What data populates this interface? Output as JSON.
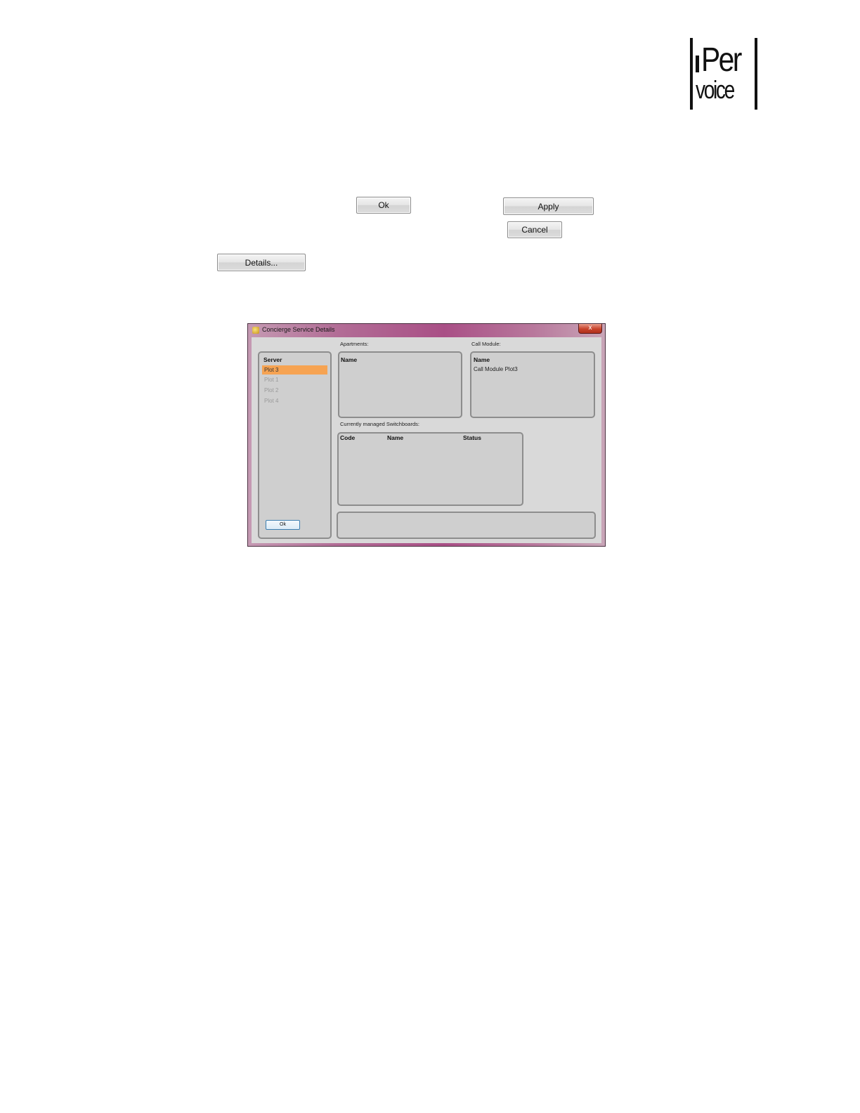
{
  "logo": {
    "line1": "Per",
    "line2": "voice"
  },
  "buttons": {
    "ok": "Ok",
    "apply": "Apply",
    "cancel": "Cancel",
    "details": "Details..."
  },
  "dialog": {
    "title": "Concierge Service Details",
    "close_glyph": "x",
    "server_list": {
      "header": "Server",
      "items": [
        "Plot 3",
        "Plot 1",
        "Plot 2",
        "Plot 4"
      ],
      "selected_index": 0
    },
    "apartments": {
      "caption": "Apartments:",
      "header": "Name"
    },
    "call_module": {
      "caption": "Call Module:",
      "header": "Name",
      "rows": [
        "Call Module Plot3"
      ]
    },
    "switchboards": {
      "caption": "Currently managed Switchboards:",
      "columns": [
        "Code",
        "Name",
        "Status"
      ]
    },
    "ok_label": "Ok"
  },
  "colors": {
    "selection": "#f6a352",
    "titlebar": "#a94f86",
    "close_button": "#c8432c"
  }
}
